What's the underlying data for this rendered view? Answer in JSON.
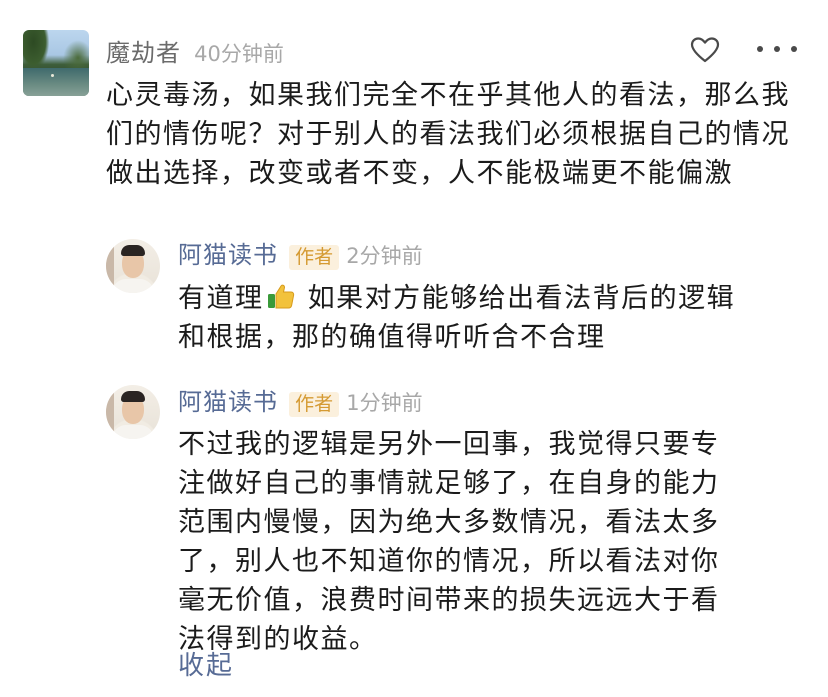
{
  "main_comment": {
    "author": "魔劫者",
    "time": "40分钟前",
    "text": "心灵毒汤，如果我们完全不在乎其他人的看法，那么我们的情伤呢？对于别人的看法我们必须根据自己的情况做出选择，改变或者不变，人不能极端更不能偏激",
    "icons": {
      "like": "heart-icon",
      "more": "more-icon"
    }
  },
  "replies": [
    {
      "author": "阿猫读书",
      "badge": "作者",
      "time": "2分钟前",
      "text_before_emoji": "有道理",
      "emoji": "thumbs-up-icon",
      "text_after_emoji": " 如果对方能够给出看法背后的逻辑和根据，那的确值得听听合不合理"
    },
    {
      "author": "阿猫读书",
      "badge": "作者",
      "time": "1分钟前",
      "text": "不过我的逻辑是另外一回事，我觉得只要专注做好自己的事情就足够了，在自身的能力范围内慢慢，因为绝大多数情况，看法太多了，别人也不知道你的情况，所以看法对你毫无价值，浪费时间带来的损失远远大于看法得到的收益。"
    }
  ],
  "collapse_label": "收起",
  "colors": {
    "link": "#576b95",
    "badge_text": "#d59a32",
    "badge_bg": "#fbf0dd",
    "meta": "#a8a8a8"
  }
}
